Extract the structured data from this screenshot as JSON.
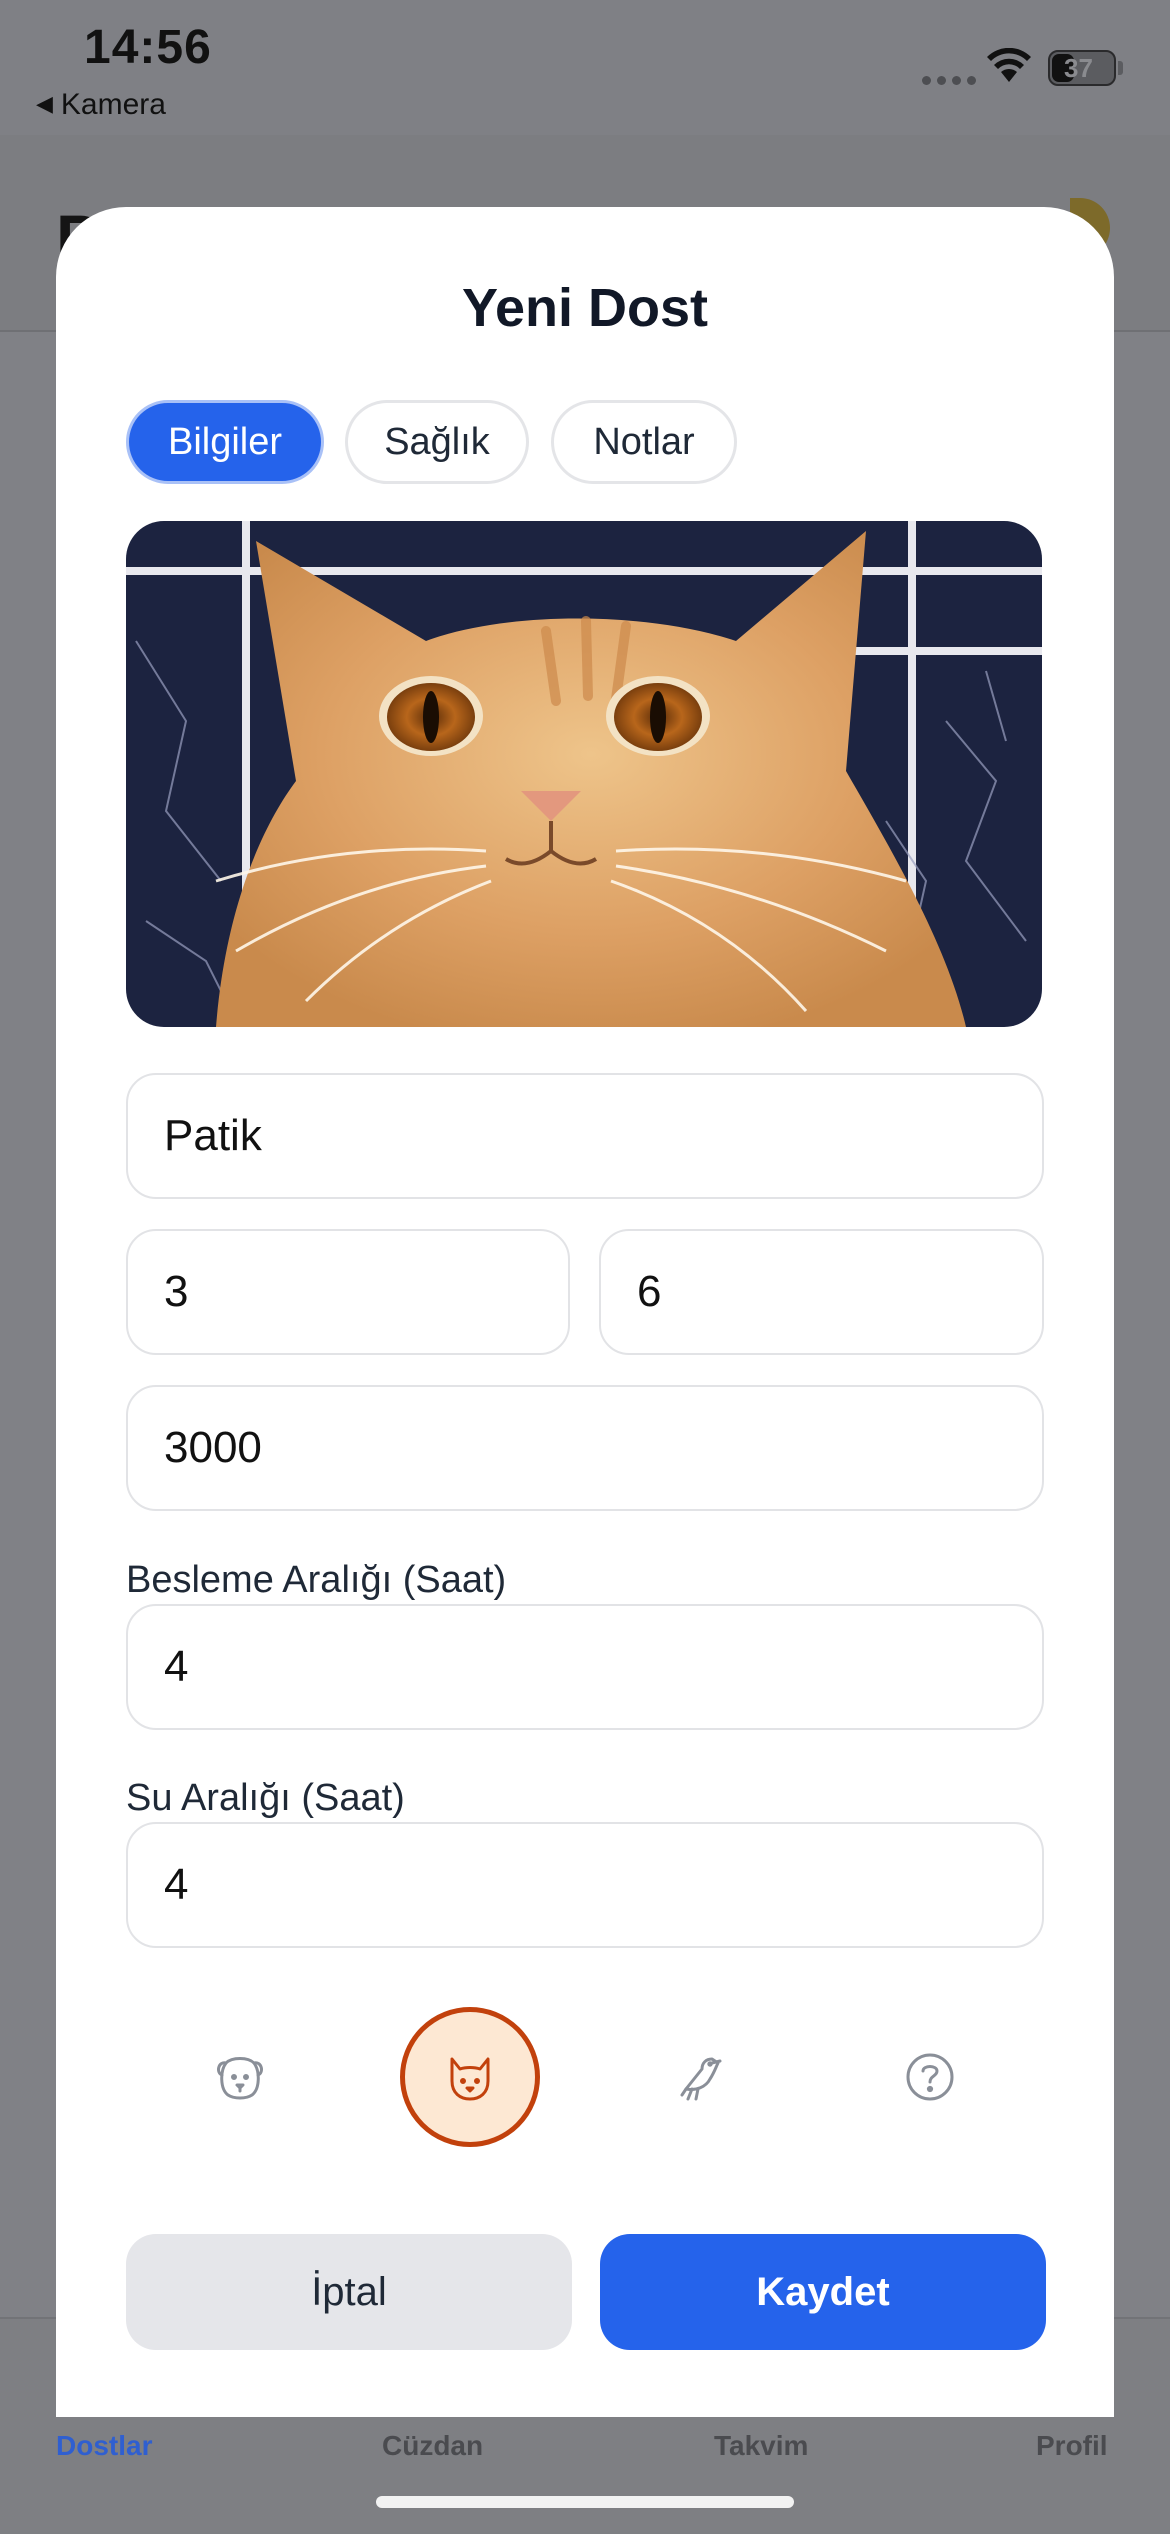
{
  "status_bar": {
    "time": "14:56",
    "back_label": "Kamera",
    "battery": "37"
  },
  "background_app": {
    "title": "P",
    "tabbar": [
      "Dostlar",
      "Cüzdan",
      "Takvim",
      "Profil"
    ],
    "active_tab_color": "#2f5fd0"
  },
  "modal": {
    "title": "Yeni Dost",
    "tabs": [
      {
        "label": "Bilgiler",
        "active": true
      },
      {
        "label": "Sağlık",
        "active": false
      },
      {
        "label": "Notlar",
        "active": false
      }
    ],
    "photo_description_icon": "pet-photo",
    "fields": {
      "name": "Patik",
      "age_years": "3",
      "age_months": "6",
      "amount": "3000",
      "feeding_label": "Besleme Aralığı (Saat)",
      "feeding_value": "4",
      "water_label": "Su Aralığı (Saat)",
      "water_value": "4"
    },
    "pet_types": [
      {
        "icon": "dog-icon",
        "selected": false
      },
      {
        "icon": "cat-icon",
        "selected": true
      },
      {
        "icon": "bird-icon",
        "selected": false
      },
      {
        "icon": "question-icon",
        "selected": false
      }
    ],
    "buttons": {
      "cancel": "İptal",
      "save": "Kaydet"
    },
    "colors": {
      "primary": "#2563eb",
      "selected_type": "#c2410c"
    }
  }
}
